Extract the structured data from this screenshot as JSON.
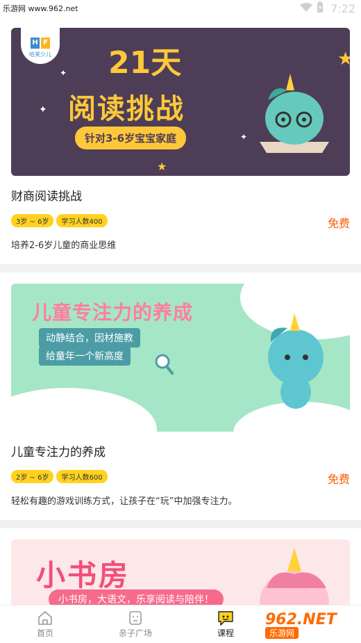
{
  "status_bar": {
    "watermark": "乐游网 www.962.net",
    "time": "7:22"
  },
  "courses": [
    {
      "banner": {
        "logo_text": "哈芙少儿",
        "logo_letters": [
          "H",
          "F"
        ],
        "days": "21天",
        "headline": "阅读挑战",
        "pill": "针对3-6岁宝宝家庭"
      },
      "title": "财商阅读挑战",
      "tags": [
        "3岁 ~ 6岁",
        "学习人数400"
      ],
      "price": "免费",
      "description": "培养2-6岁儿童的商业思维"
    },
    {
      "banner": {
        "headline": "儿童专注力的养成",
        "pill1": "动静结合，因材施教",
        "pill2": "给童年一个新高度"
      },
      "title": "儿童专注力的养成",
      "tags": [
        "2岁 ~ 6岁",
        "学习人数600"
      ],
      "price": "免费",
      "description": "轻松有趣的游戏训练方式，让孩子在“玩”中加强专注力。"
    },
    {
      "banner": {
        "headline": "小书房",
        "pill": "小书房，大语文，乐享阅读与陪伴！"
      }
    }
  ],
  "bottom_nav": {
    "items": [
      {
        "label": "首页",
        "icon": "home-icon"
      },
      {
        "label": "亲子广场",
        "icon": "square-icon"
      },
      {
        "label": "课程",
        "icon": "course-icon",
        "active": true
      }
    ],
    "watermark_big": "962.NET",
    "watermark_small": "乐游网"
  }
}
